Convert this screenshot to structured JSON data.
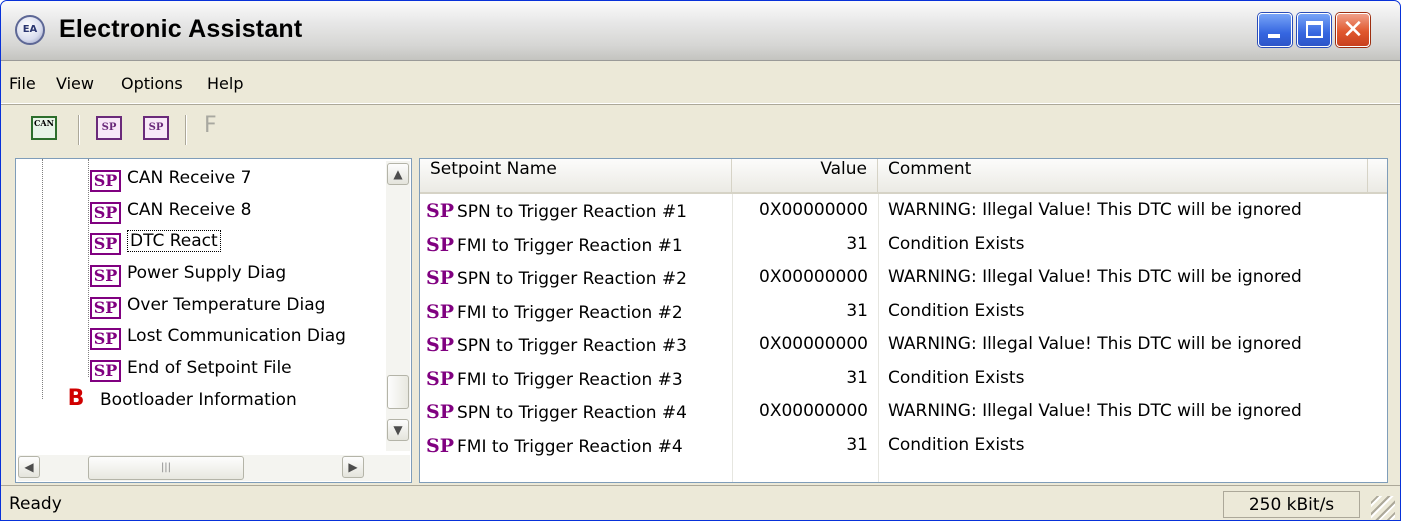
{
  "window": {
    "title": "Electronic Assistant",
    "app_icon_text": "EA"
  },
  "menu": [
    "File",
    "View",
    "Options",
    "Help"
  ],
  "toolbar": {
    "can_label": "CAN",
    "sp_label": "SP",
    "f_label": "F"
  },
  "tree": {
    "sp_badge": "SP",
    "b_badge": "B",
    "items": [
      "CAN Receive 7",
      "CAN Receive 8",
      "DTC React",
      "Power Supply Diag",
      "Over Temperature Diag",
      "Lost Communication Diag",
      "End of Setpoint File"
    ],
    "selected": "DTC React",
    "bootloader": "Bootloader Information",
    "scroll_thumb_grip": "|||"
  },
  "table": {
    "headers": [
      "Setpoint Name",
      "Value",
      "Comment"
    ],
    "row_icon": "SP",
    "rows": [
      {
        "name": "SPN to Trigger Reaction #1",
        "value": "0X00000000",
        "comment": "WARNING: Illegal Value! This DTC will be ignored"
      },
      {
        "name": "FMI to Trigger Reaction #1",
        "value": "31",
        "comment": "Condition Exists"
      },
      {
        "name": "SPN to Trigger Reaction #2",
        "value": "0X00000000",
        "comment": "WARNING: Illegal Value! This DTC will be ignored"
      },
      {
        "name": "FMI to Trigger Reaction #2",
        "value": "31",
        "comment": "Condition Exists"
      },
      {
        "name": "SPN to Trigger Reaction #3",
        "value": "0X00000000",
        "comment": "WARNING: Illegal Value! This DTC will be ignored"
      },
      {
        "name": "FMI to Trigger Reaction #3",
        "value": "31",
        "comment": "Condition Exists"
      },
      {
        "name": "SPN to Trigger Reaction #4",
        "value": "0X00000000",
        "comment": "WARNING: Illegal Value! This DTC will be ignored"
      },
      {
        "name": "FMI to Trigger Reaction #4",
        "value": "31",
        "comment": "Condition Exists"
      }
    ]
  },
  "status": {
    "text": "Ready",
    "rate": "250 kBit/s"
  },
  "colors": {
    "sp_badge": "#800080",
    "b_badge": "#d00000",
    "selection_border": "#000000"
  }
}
